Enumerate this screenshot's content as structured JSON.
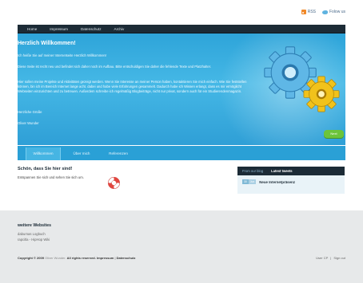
{
  "toplinks": {
    "rss": "RSS",
    "follow": "Folow us"
  },
  "nav": [
    "Home",
    "Impressum",
    "Datenschutz",
    "Archiv"
  ],
  "hero": {
    "title": "Herzlich Willkommen!",
    "p1": "Ich heiße Sie auf meiner Internetseite Herzlich Willkommen!",
    "p2": "Diese Seite ist recht neu und befindet sich daher noch im Aufbau. Bitte entschuldigen Sie daher die fehlende Texte und Platzhalter.",
    "p3": "Hier sollen meine Projekte und Aktivitäten gezeigt werden. Wenn Sie Interesse an meiner Person haben, kontaktieren Sie mich einfach. Wie Sie feststellen können, bin ich im Bereich Internet lange acht. dabei und habe viele Erfahrungen gesammelt. Dadurch habe ich Wissen erlangt, dass es mir ermöglicht Webseiten einzurichten und zu betreuen. Außerdem schreibe ich regelmäßig Blogbeiträge, nicht nur privat, sondern auch für ein Studierendenmagazin.",
    "greeting": "Herzliche Grüße",
    "name": "Oliver Wunder",
    "next": "Next"
  },
  "tabs": [
    "Willkommen",
    "Über mich",
    "Referenzen"
  ],
  "content": {
    "title": "Schön, dass Sie hier sind!",
    "text": "Entspannen Sie sich und sehen Sie sich um."
  },
  "blog": {
    "tab_blog": "From our blog",
    "tab_latest": "Latest tweets",
    "date_day": "30",
    "date_month": "Jun",
    "post_title": "Neue Internetpräsenz"
  },
  "footer": {
    "title": "weitere Websites",
    "links": [
      "daburnas Logbuch",
      "rapcitla - HipHop Wiki"
    ],
    "copyright": "Copyright © 2009",
    "author": "Oliver Wunder.",
    "rights": "All rights reserved.",
    "impressum": "Impressum",
    "sep": "|",
    "datenschutz": "Datenschutz",
    "user_cp": "User CP",
    "sign_out": "Sign out"
  },
  "colors": {
    "accent": "#2ea4d9",
    "nav_dark": "#1c2b36",
    "button_green": "#6cc43a",
    "footer_bg": "#e7e9ea"
  }
}
